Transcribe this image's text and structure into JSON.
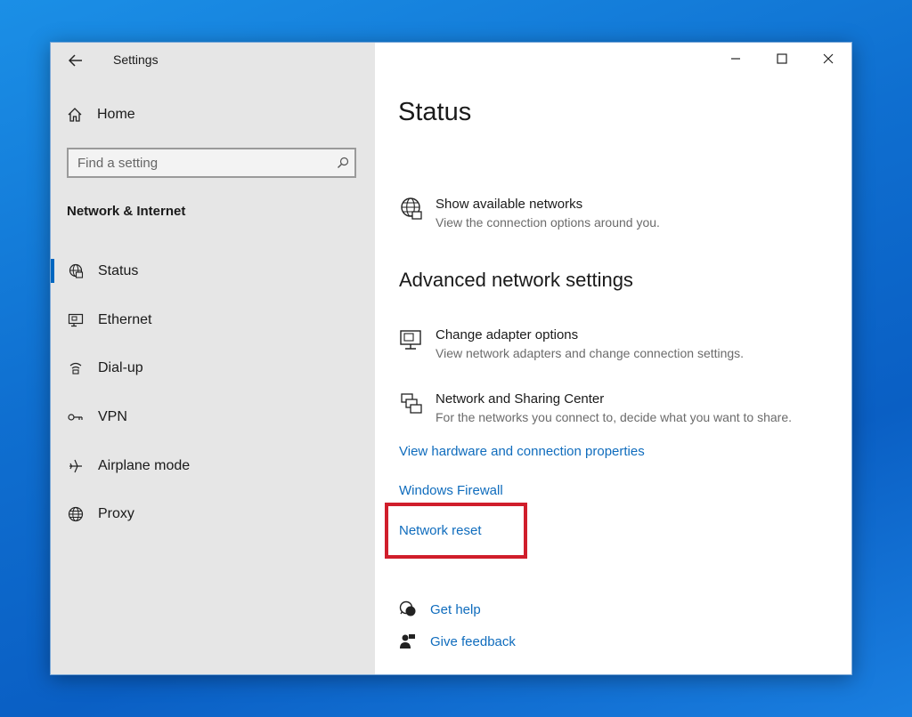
{
  "window": {
    "title": "Settings",
    "controls": {
      "minimize_icon": "minimize-icon",
      "maximize_icon": "maximize-icon",
      "close_icon": "close-icon"
    }
  },
  "sidebar": {
    "home_label": "Home",
    "search_placeholder": "Find a setting",
    "section_title": "Network & Internet",
    "items": [
      {
        "label": "Status",
        "icon": "status-globe-icon",
        "active": true
      },
      {
        "label": "Ethernet",
        "icon": "ethernet-icon",
        "active": false
      },
      {
        "label": "Dial-up",
        "icon": "dialup-icon",
        "active": false
      },
      {
        "label": "VPN",
        "icon": "vpn-icon",
        "active": false
      },
      {
        "label": "Airplane mode",
        "icon": "airplane-icon",
        "active": false
      },
      {
        "label": "Proxy",
        "icon": "proxy-globe-icon",
        "active": false
      }
    ]
  },
  "main": {
    "title": "Status",
    "show_networks": {
      "title": "Show available networks",
      "subtitle": "View the connection options around you."
    },
    "advanced_heading": "Advanced network settings",
    "change_adapter": {
      "title": "Change adapter options",
      "subtitle": "View network adapters and change connection settings."
    },
    "sharing_center": {
      "title": "Network and Sharing Center",
      "subtitle": "For the networks you connect to, decide what you want to share."
    },
    "links": {
      "hardware": "View hardware and connection properties",
      "firewall": "Windows Firewall",
      "reset": "Network reset"
    },
    "help": {
      "get_help": "Get help",
      "feedback": "Give feedback"
    }
  },
  "colors": {
    "accent": "#0067c0",
    "link": "#0f6cbd",
    "highlight_box": "#d01e2b",
    "sidebar_bg": "#e6e6e6"
  }
}
